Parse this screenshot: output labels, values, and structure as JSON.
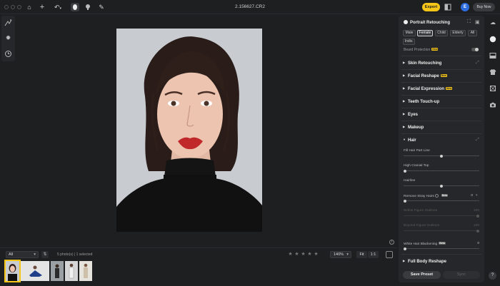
{
  "titlebar": {
    "file_name": "2.156627.CR2",
    "export_label": "Export",
    "user_initial": "E",
    "buy_now_label": "Buy Now"
  },
  "bottombar": {
    "filter_value": "All",
    "photo_count": "5 photo(s) | 1 selected",
    "rating_stars": [
      "★",
      "★",
      "★",
      "★",
      "★"
    ],
    "zoom_value": "140%",
    "fit_label": "Fit",
    "one_to_one_label": "1:1"
  },
  "panel": {
    "title": "Portrait Retouching",
    "gender_options": [
      "Male",
      "Female",
      "Child",
      "Elderly",
      "All"
    ],
    "gender_selected": "Female",
    "extra_option": "Indiv.",
    "beard_protection_label": "Beard Protection",
    "new_badge": "New",
    "beta_badge": "Beta",
    "sections": [
      {
        "label": "Skin Retouching",
        "badge": ""
      },
      {
        "label": "Facial Reshape",
        "badge": "New"
      },
      {
        "label": "Facial Expression",
        "badge": "New"
      },
      {
        "label": "Teeth Touch-up",
        "badge": ""
      },
      {
        "label": "Eyes",
        "badge": ""
      },
      {
        "label": "Makeup",
        "badge": ""
      },
      {
        "label": "Hair",
        "badge": ""
      }
    ],
    "hair_sliders": [
      {
        "label": "Fill Hair Part Line",
        "level": 0.5,
        "dim": false
      },
      {
        "label": "High Cranial Top",
        "level": 0.0,
        "dim": false
      },
      {
        "label": "Hairline",
        "level": 0.5,
        "dim": false
      }
    ],
    "stray_label": "Remove Stray Hairs",
    "stray_value": "0",
    "stray_level": 0.0,
    "dim_sliders": [
      {
        "label": "Within Figure Outlines",
        "value": "100",
        "level": 1.0
      },
      {
        "label": "Beyond Figure Outlines",
        "value": "100",
        "level": 1.0
      }
    ],
    "white_hair_label": "White Hair Blackening",
    "white_hair_value": "0",
    "white_hair_level": 0.0,
    "full_body_label": "Full Body Reshape",
    "save_preset_label": "Save Preset",
    "sync_label": "Sync"
  },
  "help_label": "?"
}
